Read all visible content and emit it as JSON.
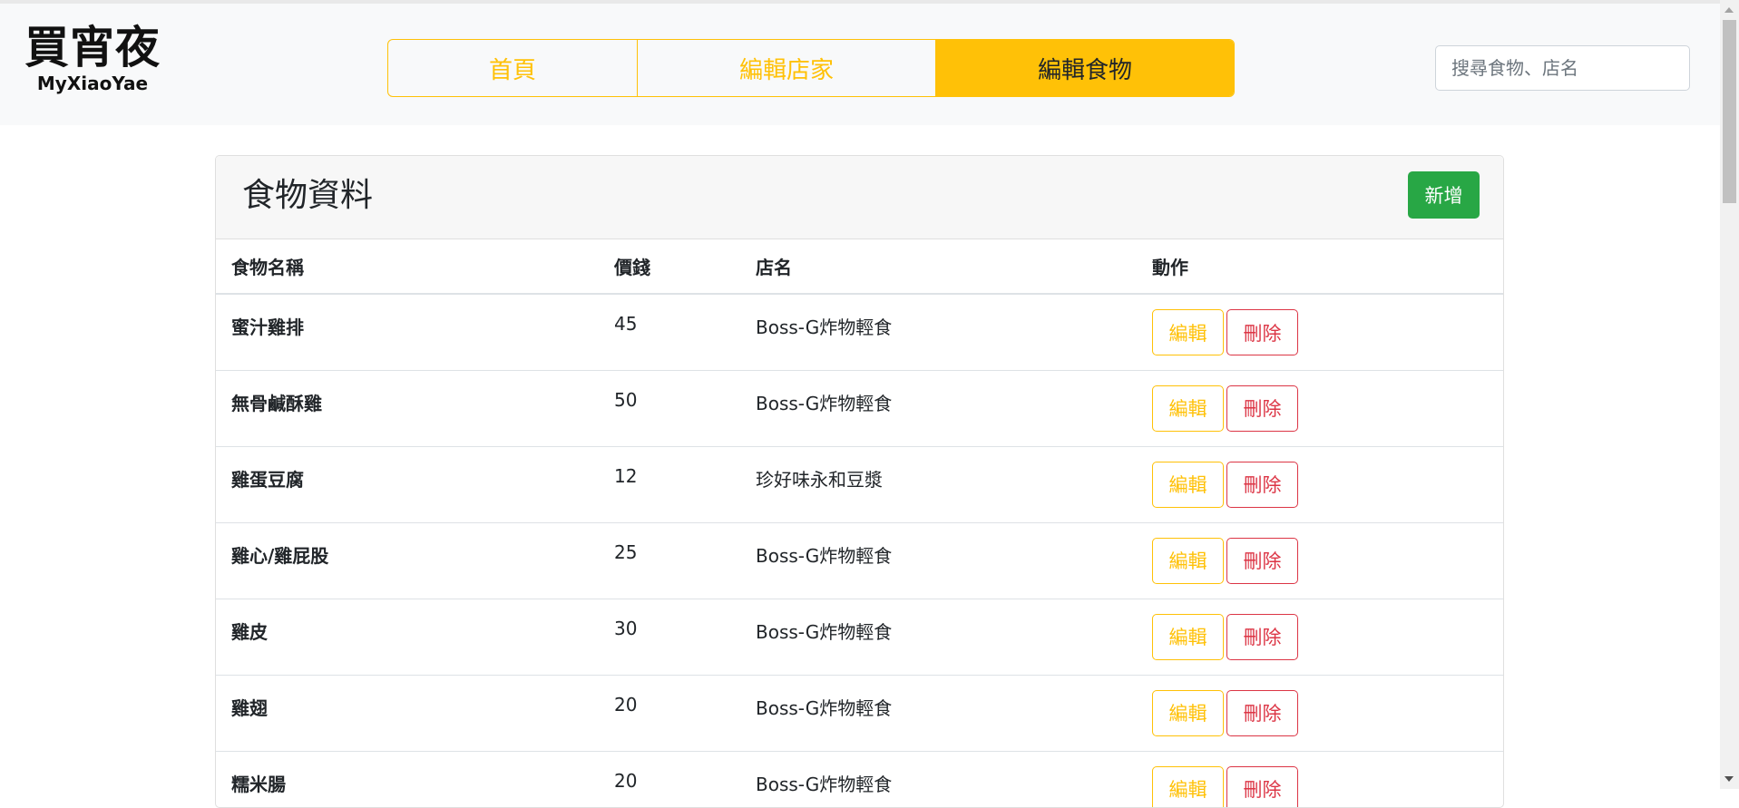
{
  "brand": {
    "title_zh": "買宵夜",
    "title_en": "MyXiaoYae"
  },
  "nav": {
    "tabs": [
      {
        "label": "首頁",
        "active": false
      },
      {
        "label": "編輯店家",
        "active": false
      },
      {
        "label": "編輯食物",
        "active": true
      }
    ]
  },
  "search": {
    "placeholder": "搜尋食物、店名",
    "value": ""
  },
  "panel": {
    "title": "食物資料",
    "add_label": "新增"
  },
  "table": {
    "headers": [
      "食物名稱",
      "價錢",
      "店名",
      "動作"
    ],
    "edit_label": "編輯",
    "delete_label": "刪除",
    "rows": [
      {
        "name": "蜜汁雞排",
        "price": "45",
        "store": "Boss-G炸物輕食"
      },
      {
        "name": "無骨鹹酥雞",
        "price": "50",
        "store": "Boss-G炸物輕食"
      },
      {
        "name": "雞蛋豆腐",
        "price": "12",
        "store": "珍好味永和豆漿"
      },
      {
        "name": "雞心/雞屁股",
        "price": "25",
        "store": "Boss-G炸物輕食"
      },
      {
        "name": "雞皮",
        "price": "30",
        "store": "Boss-G炸物輕食"
      },
      {
        "name": "雞翅",
        "price": "20",
        "store": "Boss-G炸物輕食"
      },
      {
        "name": "糯米腸",
        "price": "20",
        "store": "Boss-G炸物輕食"
      }
    ]
  },
  "colors": {
    "accent": "#ffc107",
    "success": "#28a745",
    "danger": "#dc3545",
    "navbar_bg": "#f8f9fa"
  }
}
